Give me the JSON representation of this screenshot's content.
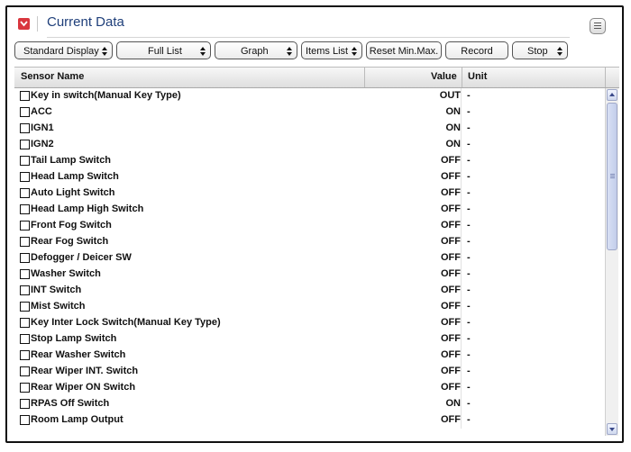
{
  "header": {
    "title": "Current Data"
  },
  "toolbar": {
    "standard_display": "Standard Display",
    "full_list": "Full List",
    "graph": "Graph",
    "items_list": "Items List",
    "reset_min_max": "Reset Min.Max.",
    "record": "Record",
    "stop": "Stop"
  },
  "table": {
    "columns": {
      "name": "Sensor Name",
      "value": "Value",
      "unit": "Unit"
    },
    "rows": [
      {
        "name": "Key in switch(Manual Key Type)",
        "value": "OUT",
        "unit": "-"
      },
      {
        "name": "ACC",
        "value": "ON",
        "unit": "-"
      },
      {
        "name": "IGN1",
        "value": "ON",
        "unit": "-"
      },
      {
        "name": "IGN2",
        "value": "ON",
        "unit": "-"
      },
      {
        "name": "Tail Lamp Switch",
        "value": "OFF",
        "unit": "-"
      },
      {
        "name": "Head Lamp Switch",
        "value": "OFF",
        "unit": "-"
      },
      {
        "name": "Auto Light Switch",
        "value": "OFF",
        "unit": "-"
      },
      {
        "name": "Head Lamp High Switch",
        "value": "OFF",
        "unit": "-"
      },
      {
        "name": "Front Fog Switch",
        "value": "OFF",
        "unit": "-"
      },
      {
        "name": "Rear Fog Switch",
        "value": "OFF",
        "unit": "-"
      },
      {
        "name": "Defogger / Deicer SW",
        "value": "OFF",
        "unit": "-"
      },
      {
        "name": "Washer Switch",
        "value": "OFF",
        "unit": "-"
      },
      {
        "name": "INT Switch",
        "value": "OFF",
        "unit": "-"
      },
      {
        "name": "Mist Switch",
        "value": "OFF",
        "unit": "-"
      },
      {
        "name": "Key Inter Lock Switch(Manual Key Type)",
        "value": "OFF",
        "unit": "-"
      },
      {
        "name": "Stop Lamp Switch",
        "value": "OFF",
        "unit": "-"
      },
      {
        "name": "Rear Washer Switch",
        "value": "OFF",
        "unit": "-"
      },
      {
        "name": "Rear Wiper INT. Switch",
        "value": "OFF",
        "unit": "-"
      },
      {
        "name": "Rear Wiper ON Switch",
        "value": "OFF",
        "unit": "-"
      },
      {
        "name": "RPAS Off Switch",
        "value": "ON",
        "unit": "-"
      },
      {
        "name": "Room Lamp Output",
        "value": "OFF",
        "unit": "-"
      }
    ]
  },
  "colors": {
    "title": "#1f3f7a",
    "collapse_button": "#d9363e"
  },
  "icons": {
    "collapse": "chevron-down-icon",
    "menu": "menu-icon"
  }
}
